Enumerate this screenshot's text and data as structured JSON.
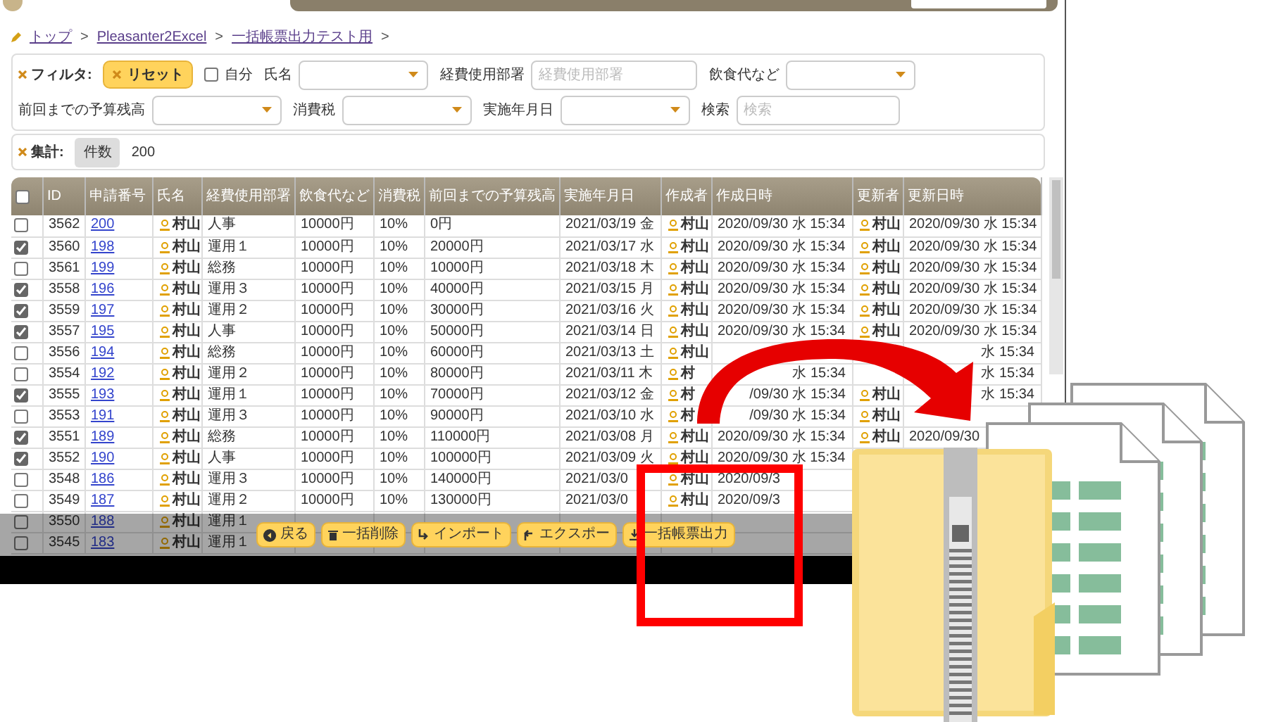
{
  "breadcrumb": [
    "トップ",
    "Pleasanter2Excel",
    "一括帳票出力テスト用"
  ],
  "breadcrumb_separator": ">",
  "filter": {
    "label": "フィルタ:",
    "reset": "リセット",
    "self": {
      "label": "自分",
      "checked": false
    },
    "field_rows": [
      [
        {
          "label": "氏名",
          "kind": "select"
        },
        {
          "label": "経費使用部署",
          "kind": "input",
          "placeholder": "経費使用部署"
        },
        {
          "label": "飲食代など",
          "kind": "select"
        }
      ],
      [
        {
          "label": "前回までの予算残高",
          "kind": "select"
        },
        {
          "label": "消費税",
          "kind": "select"
        },
        {
          "label": "実施年月日",
          "kind": "select"
        },
        {
          "label": "検索",
          "kind": "input",
          "placeholder": "検索"
        }
      ]
    ]
  },
  "aggregate": {
    "label": "集計:",
    "kind": "件数",
    "count": "200"
  },
  "table": {
    "all_checked": false,
    "columns": [
      "ID",
      "申請番号",
      "氏名",
      "経費使用部署",
      "飲食代など",
      "消費税",
      "前回までの予算残高",
      "実施年月日",
      "作成者",
      "作成日時",
      "更新者",
      "更新日時"
    ],
    "rows": [
      {
        "checked": false,
        "cells": [
          "3562",
          "200",
          "村山",
          "人事",
          "10000円",
          "10%",
          "0円",
          "2021/03/19 金",
          "村山",
          "2020/09/30 水 15:34",
          "村山",
          "2020/09/30 水 15:34"
        ]
      },
      {
        "checked": true,
        "cells": [
          "3560",
          "198",
          "村山",
          "運用１",
          "10000円",
          "10%",
          "20000円",
          "2021/03/17 水",
          "村山",
          "2020/09/30 水 15:34",
          "村山",
          "2020/09/30 水 15:34"
        ]
      },
      {
        "checked": false,
        "cells": [
          "3561",
          "199",
          "村山",
          "総務",
          "10000円",
          "10%",
          "10000円",
          "2021/03/18 木",
          "村山",
          "2020/09/30 水 15:34",
          "村山",
          "2020/09/30 水 15:34"
        ]
      },
      {
        "checked": true,
        "cells": [
          "3558",
          "196",
          "村山",
          "運用３",
          "10000円",
          "10%",
          "40000円",
          "2021/03/15 月",
          "村山",
          "2020/09/30 水 15:34",
          "村山",
          "2020/09/30 水 15:34"
        ]
      },
      {
        "checked": true,
        "cells": [
          "3559",
          "197",
          "村山",
          "運用２",
          "10000円",
          "10%",
          "30000円",
          "2021/03/16 火",
          "村山",
          "2020/09/30 水 15:34",
          "村山",
          "2020/09/30 水 15:34"
        ]
      },
      {
        "checked": true,
        "cells": [
          "3557",
          "195",
          "村山",
          "人事",
          "10000円",
          "10%",
          "50000円",
          "2021/03/14 日",
          "村山",
          "2020/09/30 水 15:34",
          "村山",
          "2020/09/30 水 15:34"
        ]
      },
      {
        "checked": false,
        "cells": [
          "3556",
          "194",
          "村山",
          "総務",
          "10000円",
          "10%",
          "60000円",
          "2021/03/13 土",
          "村山",
          "",
          "",
          {
            "text": "水 15:34",
            "hidden_start": true
          }
        ]
      },
      {
        "checked": false,
        "cells": [
          "3554",
          "192",
          "村山",
          "運用２",
          "10000円",
          "10%",
          "80000円",
          "2021/03/11 木",
          "村",
          {
            "text": "水 15:34",
            "hidden_start": true
          },
          "",
          {
            "text": "水 15:34",
            "hidden_start": true
          }
        ]
      },
      {
        "checked": true,
        "cells": [
          "3555",
          "193",
          "村山",
          "運用１",
          "10000円",
          "10%",
          "70000円",
          "2021/03/12 金",
          "村",
          {
            "text": "/09/30 水 15:34",
            "hidden_start": true
          },
          "村山",
          {
            "text": "水 15:34",
            "hidden_start": true
          }
        ]
      },
      {
        "checked": false,
        "cells": [
          "3553",
          "191",
          "村山",
          "運用３",
          "10000円",
          "10%",
          "90000円",
          "2021/03/10 水",
          "村",
          {
            "text": "/09/30 水 15:34",
            "hidden_start": true
          },
          "村山",
          ""
        ]
      },
      {
        "checked": true,
        "cells": [
          "3551",
          "189",
          "村山",
          "総務",
          "10000円",
          "10%",
          "110000円",
          "2021/03/08 月",
          "村山",
          "2020/09/30 水 15:34",
          "村山",
          "2020/09/30"
        ]
      },
      {
        "checked": true,
        "cells": [
          "3552",
          "190",
          "村山",
          "人事",
          "10000円",
          "10%",
          "100000円",
          "2021/03/09 火",
          "村山",
          "2020/09/30 水 15:34",
          "",
          ""
        ]
      },
      {
        "checked": false,
        "cells": [
          "3548",
          "186",
          "村山",
          "運用３",
          "10000円",
          "10%",
          "140000円",
          "2021/03/0",
          "村山",
          "2020/09/3",
          "",
          ""
        ]
      },
      {
        "checked": false,
        "cells": [
          "3549",
          "187",
          "村山",
          "運用２",
          "10000円",
          "10%",
          "130000円",
          "2021/03/0",
          "村山",
          "2020/09/3",
          "",
          ""
        ]
      },
      {
        "checked": false,
        "cells": [
          "3550",
          "188",
          "村山",
          "運用１",
          "",
          "",
          "",
          "",
          "",
          "",
          "",
          ""
        ]
      },
      {
        "checked": false,
        "cells": [
          "3545",
          "183",
          "村山",
          "運用１",
          "",
          "",
          "",
          "",
          "",
          "",
          "",
          ""
        ]
      }
    ]
  },
  "footer_buttons": [
    {
      "label": "戻る",
      "kind": "back"
    },
    {
      "label": "一括削除",
      "kind": "delete"
    },
    {
      "label": "インポート",
      "kind": "import"
    },
    {
      "label": "エクスポー",
      "kind": "export"
    },
    {
      "label": "一括帳票出力",
      "kind": "download"
    }
  ]
}
